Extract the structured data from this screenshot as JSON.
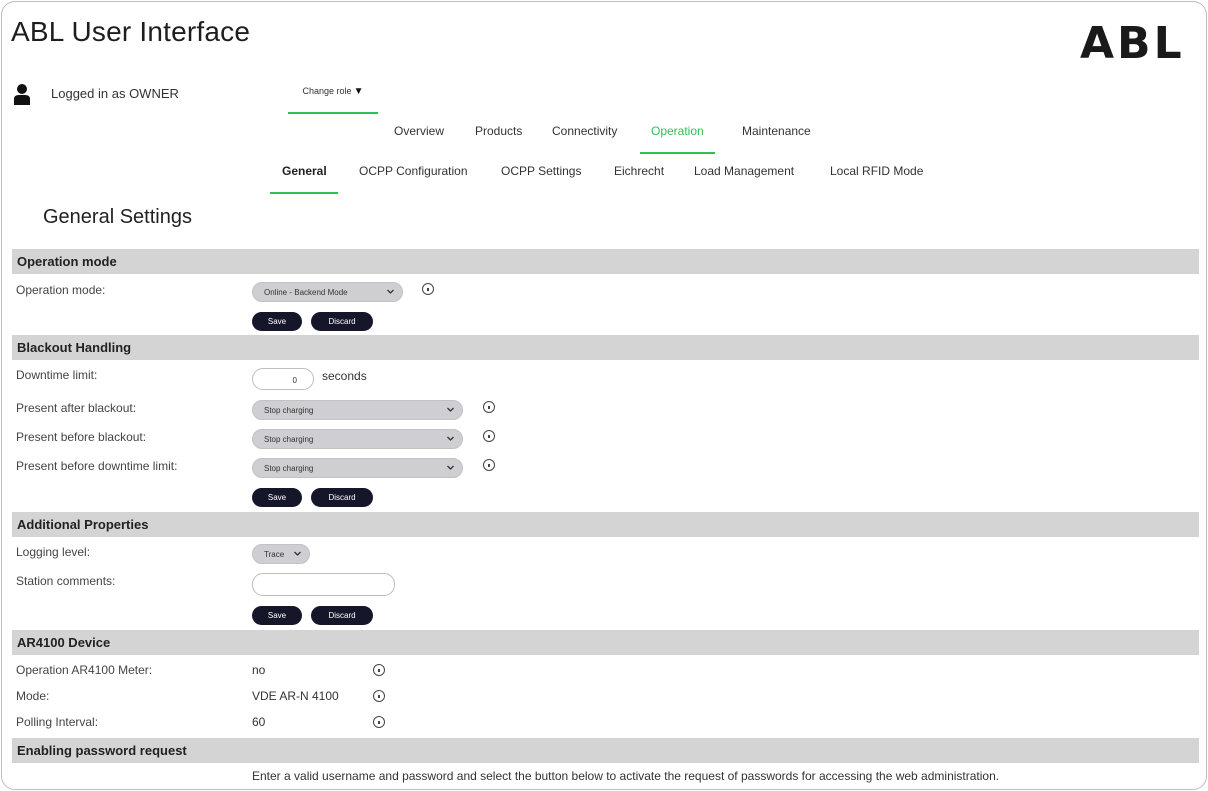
{
  "app": {
    "title": "ABL User Interface",
    "logo_text": "ABL"
  },
  "user": {
    "logged_in_text": "Logged in as OWNER",
    "change_role_label": "Change role"
  },
  "nav_main": [
    "Overview",
    "Products",
    "Connectivity",
    "Operation",
    "Maintenance"
  ],
  "nav_main_active": "Operation",
  "nav_sub": [
    "General",
    "OCPP Configuration",
    "OCPP Settings",
    "Eichrecht",
    "Load Management",
    "Local RFID Mode"
  ],
  "nav_sub_active": "General",
  "page_title": "General Settings",
  "operation_mode": {
    "header": "Operation mode",
    "label": "Operation mode:",
    "value": "Online - Backend Mode",
    "save": "Save",
    "discard": "Discard"
  },
  "blackout": {
    "header": "Blackout Handling",
    "downtime_label": "Downtime limit:",
    "downtime_value": "0",
    "downtime_unit": "seconds",
    "after_label": "Present after blackout:",
    "after_value": "Stop charging",
    "before_label": "Present before blackout:",
    "before_value": "Stop charging",
    "before_limit_label": "Present before downtime limit:",
    "before_limit_value": "Stop charging",
    "save": "Save",
    "discard": "Discard"
  },
  "additional": {
    "header": "Additional Properties",
    "logging_label": "Logging level:",
    "logging_value": "Trace",
    "comments_label": "Station comments:",
    "comments_value": "",
    "save": "Save",
    "discard": "Discard"
  },
  "ar4100": {
    "header": "AR4100 Device",
    "meter_label": "Operation AR4100 Meter:",
    "meter_value": "no",
    "mode_label": "Mode:",
    "mode_value": "VDE AR-N 4100",
    "polling_label": "Polling Interval:",
    "polling_value": "60"
  },
  "password": {
    "header": "Enabling password request",
    "description": "Enter a valid username and password and select the button below to activate the request of passwords for accessing the web administration."
  },
  "colors": {
    "accent": "#2fbf5a",
    "section_bg": "#d4d4d4",
    "button_bg": "#16162a",
    "select_bg": "#cfcfd3"
  }
}
